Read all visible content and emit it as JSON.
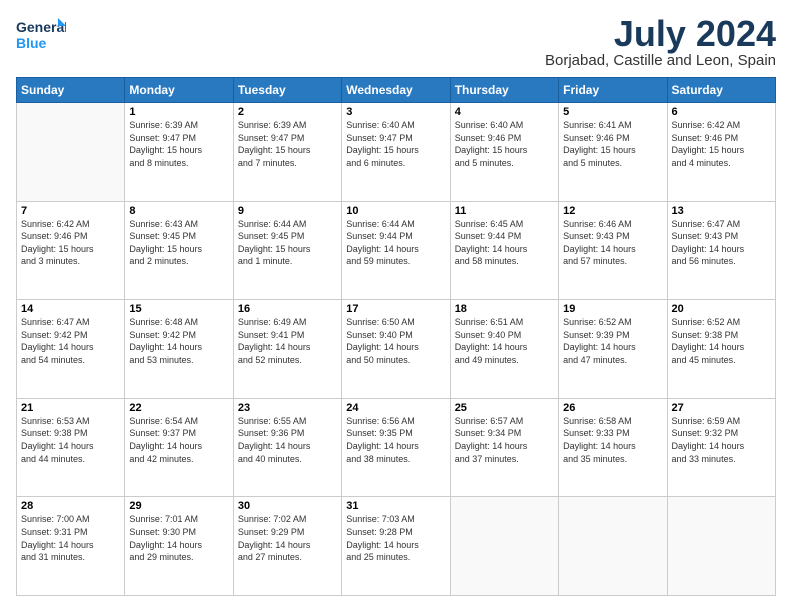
{
  "logo": {
    "line1": "General",
    "line2": "Blue"
  },
  "title": {
    "month_year": "July 2024",
    "location": "Borjabad, Castille and Leon, Spain"
  },
  "weekdays": [
    "Sunday",
    "Monday",
    "Tuesday",
    "Wednesday",
    "Thursday",
    "Friday",
    "Saturday"
  ],
  "weeks": [
    [
      {
        "day": "",
        "info": ""
      },
      {
        "day": "1",
        "info": "Sunrise: 6:39 AM\nSunset: 9:47 PM\nDaylight: 15 hours\nand 8 minutes."
      },
      {
        "day": "2",
        "info": "Sunrise: 6:39 AM\nSunset: 9:47 PM\nDaylight: 15 hours\nand 7 minutes."
      },
      {
        "day": "3",
        "info": "Sunrise: 6:40 AM\nSunset: 9:47 PM\nDaylight: 15 hours\nand 6 minutes."
      },
      {
        "day": "4",
        "info": "Sunrise: 6:40 AM\nSunset: 9:46 PM\nDaylight: 15 hours\nand 5 minutes."
      },
      {
        "day": "5",
        "info": "Sunrise: 6:41 AM\nSunset: 9:46 PM\nDaylight: 15 hours\nand 5 minutes."
      },
      {
        "day": "6",
        "info": "Sunrise: 6:42 AM\nSunset: 9:46 PM\nDaylight: 15 hours\nand 4 minutes."
      }
    ],
    [
      {
        "day": "7",
        "info": "Sunrise: 6:42 AM\nSunset: 9:46 PM\nDaylight: 15 hours\nand 3 minutes."
      },
      {
        "day": "8",
        "info": "Sunrise: 6:43 AM\nSunset: 9:45 PM\nDaylight: 15 hours\nand 2 minutes."
      },
      {
        "day": "9",
        "info": "Sunrise: 6:44 AM\nSunset: 9:45 PM\nDaylight: 15 hours\nand 1 minute."
      },
      {
        "day": "10",
        "info": "Sunrise: 6:44 AM\nSunset: 9:44 PM\nDaylight: 14 hours\nand 59 minutes."
      },
      {
        "day": "11",
        "info": "Sunrise: 6:45 AM\nSunset: 9:44 PM\nDaylight: 14 hours\nand 58 minutes."
      },
      {
        "day": "12",
        "info": "Sunrise: 6:46 AM\nSunset: 9:43 PM\nDaylight: 14 hours\nand 57 minutes."
      },
      {
        "day": "13",
        "info": "Sunrise: 6:47 AM\nSunset: 9:43 PM\nDaylight: 14 hours\nand 56 minutes."
      }
    ],
    [
      {
        "day": "14",
        "info": "Sunrise: 6:47 AM\nSunset: 9:42 PM\nDaylight: 14 hours\nand 54 minutes."
      },
      {
        "day": "15",
        "info": "Sunrise: 6:48 AM\nSunset: 9:42 PM\nDaylight: 14 hours\nand 53 minutes."
      },
      {
        "day": "16",
        "info": "Sunrise: 6:49 AM\nSunset: 9:41 PM\nDaylight: 14 hours\nand 52 minutes."
      },
      {
        "day": "17",
        "info": "Sunrise: 6:50 AM\nSunset: 9:40 PM\nDaylight: 14 hours\nand 50 minutes."
      },
      {
        "day": "18",
        "info": "Sunrise: 6:51 AM\nSunset: 9:40 PM\nDaylight: 14 hours\nand 49 minutes."
      },
      {
        "day": "19",
        "info": "Sunrise: 6:52 AM\nSunset: 9:39 PM\nDaylight: 14 hours\nand 47 minutes."
      },
      {
        "day": "20",
        "info": "Sunrise: 6:52 AM\nSunset: 9:38 PM\nDaylight: 14 hours\nand 45 minutes."
      }
    ],
    [
      {
        "day": "21",
        "info": "Sunrise: 6:53 AM\nSunset: 9:38 PM\nDaylight: 14 hours\nand 44 minutes."
      },
      {
        "day": "22",
        "info": "Sunrise: 6:54 AM\nSunset: 9:37 PM\nDaylight: 14 hours\nand 42 minutes."
      },
      {
        "day": "23",
        "info": "Sunrise: 6:55 AM\nSunset: 9:36 PM\nDaylight: 14 hours\nand 40 minutes."
      },
      {
        "day": "24",
        "info": "Sunrise: 6:56 AM\nSunset: 9:35 PM\nDaylight: 14 hours\nand 38 minutes."
      },
      {
        "day": "25",
        "info": "Sunrise: 6:57 AM\nSunset: 9:34 PM\nDaylight: 14 hours\nand 37 minutes."
      },
      {
        "day": "26",
        "info": "Sunrise: 6:58 AM\nSunset: 9:33 PM\nDaylight: 14 hours\nand 35 minutes."
      },
      {
        "day": "27",
        "info": "Sunrise: 6:59 AM\nSunset: 9:32 PM\nDaylight: 14 hours\nand 33 minutes."
      }
    ],
    [
      {
        "day": "28",
        "info": "Sunrise: 7:00 AM\nSunset: 9:31 PM\nDaylight: 14 hours\nand 31 minutes."
      },
      {
        "day": "29",
        "info": "Sunrise: 7:01 AM\nSunset: 9:30 PM\nDaylight: 14 hours\nand 29 minutes."
      },
      {
        "day": "30",
        "info": "Sunrise: 7:02 AM\nSunset: 9:29 PM\nDaylight: 14 hours\nand 27 minutes."
      },
      {
        "day": "31",
        "info": "Sunrise: 7:03 AM\nSunset: 9:28 PM\nDaylight: 14 hours\nand 25 minutes."
      },
      {
        "day": "",
        "info": ""
      },
      {
        "day": "",
        "info": ""
      },
      {
        "day": "",
        "info": ""
      }
    ]
  ]
}
